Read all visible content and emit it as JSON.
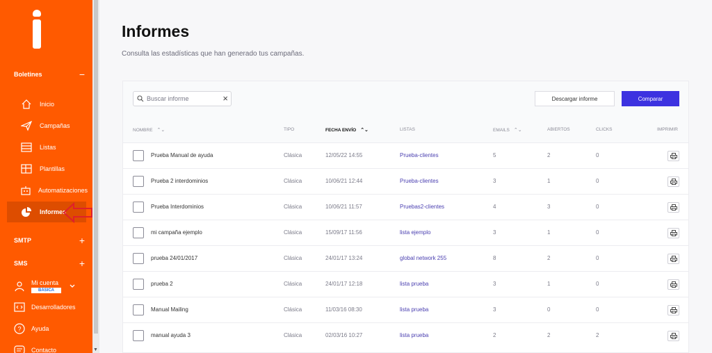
{
  "sidebar": {
    "sections": {
      "boletines": "Boletines",
      "smtp": "SMTP",
      "sms": "SMS"
    },
    "toggles": {
      "minus": "−",
      "plus": "+"
    },
    "items": [
      {
        "label": "Inicio",
        "icon": "home-icon"
      },
      {
        "label": "Campañas",
        "icon": "paper-plane-icon"
      },
      {
        "label": "Listas",
        "icon": "list-icon"
      },
      {
        "label": "Plantillas",
        "icon": "template-icon"
      },
      {
        "label": "Automatizaciones",
        "icon": "robot-icon"
      },
      {
        "label": "Informes",
        "icon": "pie-chart-icon",
        "active": true
      }
    ],
    "account": {
      "label": "Mi cuenta",
      "badge": "BÁSICA"
    },
    "developers": "Desarrolladores",
    "help": "Ayuda",
    "contact": "Contacto"
  },
  "page": {
    "title": "Informes",
    "subtitle": "Consulta las estadísticas que han generado tus campañas."
  },
  "toolbar": {
    "search_placeholder": "Buscar informe",
    "download_label": "Descargar informe",
    "compare_label": "Comparar"
  },
  "table": {
    "headers": {
      "nombre": "NOMBRE",
      "tipo": "TIPO",
      "fecha": "FECHA ENVÍO",
      "listas": "LISTAS",
      "emails": "EMAILS",
      "abiertos": "ABIERTOS",
      "clicks": "CLICKS",
      "imprimir": "IMPRIMIR"
    },
    "sort_glyph": "⌃⌄",
    "rows": [
      {
        "nombre": "Prueba Manual de ayuda",
        "tipo": "Clásica",
        "fecha": "12/05/22 14:55",
        "lista": "Prueba-clientes",
        "emails": "5",
        "abiertos": "2",
        "clicks": "0"
      },
      {
        "nombre": "Prueba 2 interdominios",
        "tipo": "Clásica",
        "fecha": "10/06/21 12:44",
        "lista": "Prueba-clientes",
        "emails": "3",
        "abiertos": "1",
        "clicks": "0"
      },
      {
        "nombre": "Prueba Interdominios",
        "tipo": "Clásica",
        "fecha": "10/06/21 11:57",
        "lista": "Pruebas2-clientes",
        "emails": "4",
        "abiertos": "3",
        "clicks": "0"
      },
      {
        "nombre": "mi campaña ejemplo",
        "tipo": "Clásica",
        "fecha": "15/09/17 11:56",
        "lista": "lista ejemplo",
        "emails": "3",
        "abiertos": "1",
        "clicks": "0"
      },
      {
        "nombre": "prueba 24/01/2017",
        "tipo": "Clásica",
        "fecha": "24/01/17 13:24",
        "lista": "global network 255",
        "emails": "8",
        "abiertos": "2",
        "clicks": "0"
      },
      {
        "nombre": "prueba 2",
        "tipo": "Clásica",
        "fecha": "24/01/17 12:18",
        "lista": "lista prueba",
        "emails": "3",
        "abiertos": "1",
        "clicks": "0"
      },
      {
        "nombre": "Manual Mailing",
        "tipo": "Clásica",
        "fecha": "11/03/16 08:30",
        "lista": "lista prueba",
        "emails": "3",
        "abiertos": "0",
        "clicks": "0"
      },
      {
        "nombre": "manual ayuda 3",
        "tipo": "Clásica",
        "fecha": "02/03/16 10:27",
        "lista": "lista prueba",
        "emails": "2",
        "abiertos": "2",
        "clicks": "2"
      }
    ]
  },
  "colors": {
    "sidebar": "#ff5a00",
    "sidebar_active": "#dd4d00",
    "primary_button": "#3d32e0",
    "link": "#4a3fb0",
    "annotation_arrow": "#e0202a"
  }
}
